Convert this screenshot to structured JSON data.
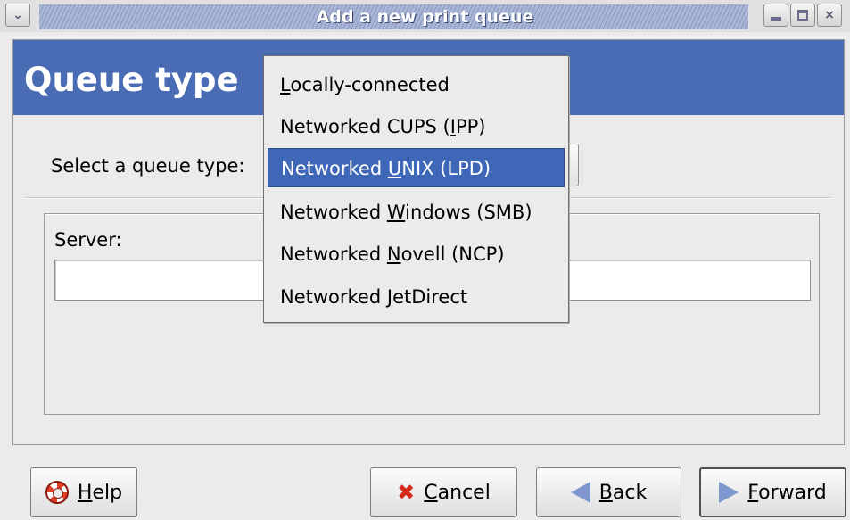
{
  "window": {
    "title": "Add a new print queue"
  },
  "header": {
    "title": "Queue type"
  },
  "form": {
    "queue_type_label": "Select a queue type:",
    "server_label": "Server:",
    "server_value": ""
  },
  "dropdown": {
    "selected_index": 2,
    "items": [
      {
        "pre": "",
        "key": "L",
        "post": "ocally-connected"
      },
      {
        "pre": "Networked CUPS (",
        "key": "I",
        "post": "PP)"
      },
      {
        "pre": "Networked ",
        "key": "U",
        "post": "NIX (LPD)"
      },
      {
        "pre": "Networked ",
        "key": "W",
        "post": "indows (SMB)"
      },
      {
        "pre": "Networked ",
        "key": "N",
        "post": "ovell (NCP)"
      },
      {
        "pre": "Networked ",
        "key": "J",
        "post": "etDirect"
      }
    ]
  },
  "buttons": {
    "help": {
      "key": "H",
      "rest": "elp"
    },
    "cancel": {
      "key": "C",
      "rest": "ancel"
    },
    "back": {
      "key": "B",
      "rest": "ack"
    },
    "forward": {
      "key": "F",
      "rest": "orward"
    }
  },
  "colors": {
    "header_band": "#4a6cb4",
    "selection": "#3f67b8"
  }
}
